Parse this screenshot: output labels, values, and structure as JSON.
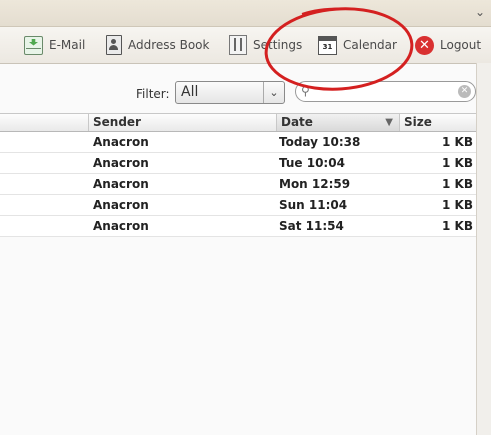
{
  "toolbar": {
    "email": "E-Mail",
    "address_book": "Address Book",
    "settings": "Settings",
    "calendar": "Calendar",
    "calendar_day": "31",
    "logout": "Logout",
    "logout_glyph": "✕"
  },
  "filter": {
    "label": "Filter:",
    "selected": "All",
    "arrow_glyph": "⌄"
  },
  "search": {
    "value": "",
    "icon_glyph": "⚲",
    "clear_glyph": "✕"
  },
  "table": {
    "headers": {
      "sender": "Sender",
      "date": "Date",
      "size": "Size",
      "sort_glyph": "▼"
    },
    "rows": [
      {
        "sender": "Anacron",
        "date": "Today 10:38",
        "size": "1 KB"
      },
      {
        "sender": "Anacron",
        "date": "Tue 10:04",
        "size": "1 KB"
      },
      {
        "sender": "Anacron",
        "date": "Mon 12:59",
        "size": "1 KB"
      },
      {
        "sender": "Anacron",
        "date": "Sun 11:04",
        "size": "1 KB"
      },
      {
        "sender": "Anacron",
        "date": "Sat 11:54",
        "size": "1 KB"
      }
    ]
  },
  "window": {
    "expand_glyph": "⌄"
  },
  "colors": {
    "annotation": "#d42020",
    "logout": "#d93030"
  }
}
